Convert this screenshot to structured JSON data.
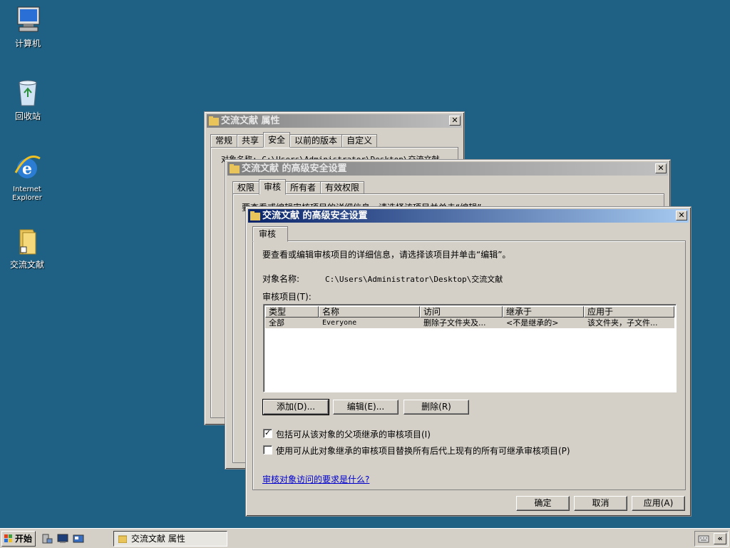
{
  "desktop": {
    "icons": [
      {
        "label": "计算机"
      },
      {
        "label": "回收站"
      },
      {
        "label": "Internet Explorer"
      },
      {
        "label": "交流文献"
      }
    ]
  },
  "window_properties": {
    "title": "交流文献 属性",
    "tabs": [
      "常规",
      "共享",
      "安全",
      "以前的版本",
      "自定义"
    ],
    "selected_tab": "安全",
    "partial_text": "对象名称:   C:\\Users\\Administrator\\Desktop\\交流文献"
  },
  "window_advanced_back": {
    "title": "交流文献 的高级安全设置",
    "tabs": [
      "权限",
      "审核",
      "所有者",
      "有效权限"
    ],
    "selected_tab": "审核",
    "partial_text": "要查看或编辑审核项目的详细信息，请选择该项目并单击“编辑”。"
  },
  "dialog": {
    "title": "交流文献 的高级安全设置",
    "tab": "审核",
    "instruction": "要查看或编辑审核项目的详细信息，请选择该项目并单击“编辑”。",
    "object_name_label": "对象名称:",
    "object_name_value": "C:\\Users\\Administrator\\Desktop\\交流文献",
    "audit_entries_label": "审核项目(T):",
    "columns": [
      "类型",
      "名称",
      "访问",
      "继承于",
      "应用于"
    ],
    "rows": [
      {
        "type": "全部",
        "name": "Everyone",
        "access": "删除子文件夹及...",
        "inherited_from": "<不是继承的>",
        "applies_to": "该文件夹，子文件..."
      }
    ],
    "buttons": {
      "add": "添加(D)...",
      "edit": "编辑(E)...",
      "remove": "删除(R)"
    },
    "checkbox_inherit": {
      "label": "包括可从该对象的父项继承的审核项目(I)",
      "checked": true
    },
    "checkbox_replace": {
      "label": "使用可从此对象继承的审核项目替换所有后代上现有的所有可继承审核项目(P)",
      "checked": false
    },
    "help_link": "审核对象访问的要求是什么?",
    "footer": {
      "ok": "确定",
      "cancel": "取消",
      "apply": "应用(A)"
    }
  },
  "taskbar": {
    "start_label": "开始",
    "task_label": "交流文献 属性"
  },
  "colors": {
    "desktop": "#1f6184",
    "title_active": "#0a246a",
    "title_inactive": "#808080",
    "window_face": "#d4d0c8"
  }
}
